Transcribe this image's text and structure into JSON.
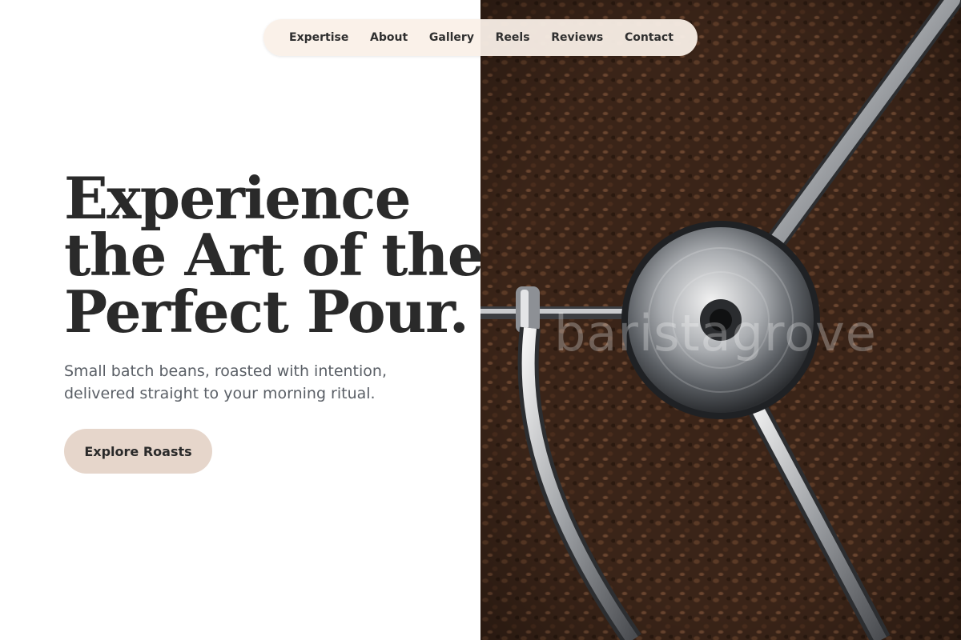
{
  "nav": {
    "items": [
      {
        "label": "Expertise"
      },
      {
        "label": "About"
      },
      {
        "label": "Gallery"
      },
      {
        "label": "Reels"
      },
      {
        "label": "Reviews"
      },
      {
        "label": "Contact"
      }
    ]
  },
  "hero": {
    "headline_lines": [
      "Experience",
      "the Art of the",
      "Perfect Pour."
    ],
    "subtitle_lines": [
      "Small batch beans, roasted with intention,",
      "delivered straight to your morning ritual."
    ],
    "cta_label": "Explore Roasts"
  },
  "photo": {
    "watermark": "baristagrove"
  },
  "colors": {
    "headline": "#2a2a2a",
    "subtitle": "#5a5f66",
    "cta_bg": "#e6d6cb",
    "nav_bg": "#faf0e8"
  }
}
